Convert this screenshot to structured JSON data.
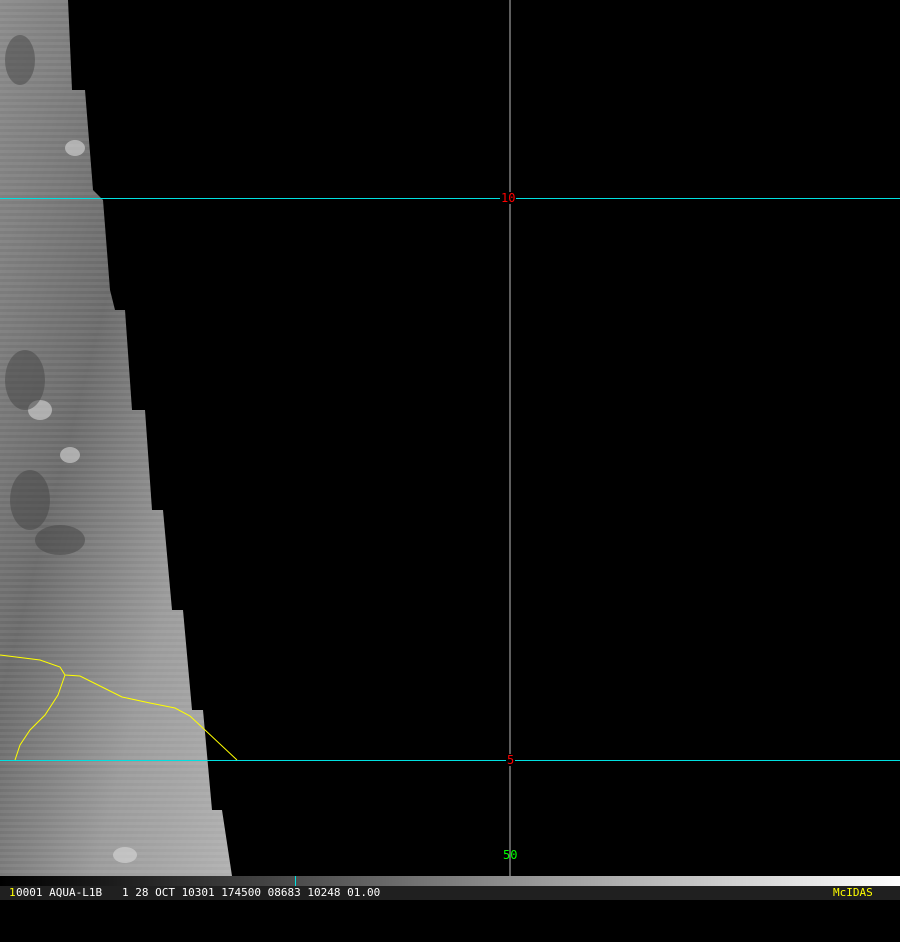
{
  "map": {
    "grid_labels": {
      "lat_10": "10",
      "lat_5": "5",
      "lon_50": "50"
    },
    "colors": {
      "grid": "#00e0e0",
      "coast": "#ffff00",
      "lat_label": "#ff0000",
      "lon_label": "#00ff00"
    }
  },
  "status_bar": {
    "frame": "1",
    "info": "0001 AQUA-L1B   1 28 OCT 10301 174500 08683 10248 01.00",
    "brand": "McIDAS"
  }
}
